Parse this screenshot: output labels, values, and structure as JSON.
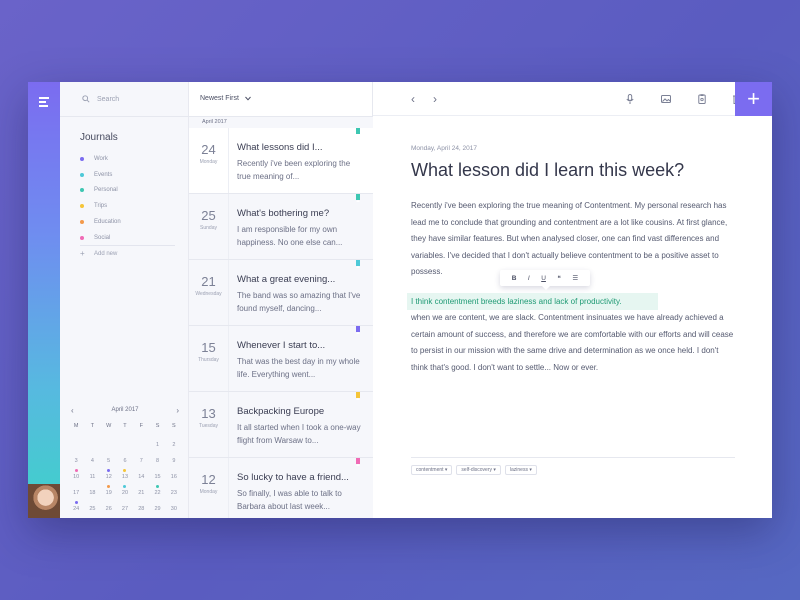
{
  "rail": {
    "menu_icon": "hamburger-icon",
    "avatar": "user-avatar"
  },
  "sidebar": {
    "search_placeholder": "Search",
    "journals_title": "Journals",
    "journals": [
      {
        "label": "Work",
        "color": "#7b6cf0"
      },
      {
        "label": "Events",
        "color": "#4ec9d8"
      },
      {
        "label": "Personal",
        "color": "#3ec7b2"
      },
      {
        "label": "Trips",
        "color": "#f5c538"
      },
      {
        "label": "Education",
        "color": "#f39a4b"
      },
      {
        "label": "Social",
        "color": "#f06bb5"
      }
    ],
    "add_new_label": "Add new",
    "calendar": {
      "month_label": "April 2017",
      "weekdays": [
        "M",
        "T",
        "W",
        "T",
        "F",
        "S",
        "S"
      ],
      "rows": [
        [
          "",
          "",
          "",
          "",
          "",
          "1",
          "2"
        ],
        [
          "3",
          "4",
          "5",
          "6",
          "7",
          "8",
          "9"
        ],
        [
          "10",
          "11",
          "12",
          "13",
          "14",
          "15",
          "16"
        ],
        [
          "17",
          "18",
          "19",
          "20",
          "21",
          "22",
          "23"
        ],
        [
          "24",
          "25",
          "26",
          "27",
          "28",
          "29",
          "30"
        ]
      ],
      "markers": {
        "10": "#f06bb5",
        "12": "#7b6cf0",
        "13": "#f5c538",
        "19": "#f39a4b",
        "20": "#4ec9d8",
        "22": "#3ec7b2",
        "24": "#7b6cf0"
      }
    }
  },
  "entries": {
    "sort_label": "Newest First",
    "month_header": "April 2017",
    "items": [
      {
        "day": "24",
        "weekday": "Monday",
        "title": "What lessons did I...",
        "snippet": "Recently i've been exploring the true meaning of...",
        "flag": "#3ec7b2",
        "shade": false
      },
      {
        "day": "25",
        "weekday": "Sunday",
        "title": "What's bothering me?",
        "snippet": "I am responsible for my own happiness. No one else can...",
        "flag": "#3ec7b2",
        "shade": true
      },
      {
        "day": "21",
        "weekday": "Wednesday",
        "title": "What a great evening...",
        "snippet": "The band was so amazing that I've found myself, dancing...",
        "flag": "#4ec9d8",
        "shade": true
      },
      {
        "day": "15",
        "weekday": "Thursday",
        "title": "Whenever I start to...",
        "snippet": "That was the best day in my whole life. Everything went...",
        "flag": "#7b6cf0",
        "shade": true
      },
      {
        "day": "13",
        "weekday": "Tuesday",
        "title": "Backpacking Europe",
        "snippet": "It all started when I took a one-way flight from Warsaw to...",
        "flag": "#f5c538",
        "shade": true
      },
      {
        "day": "12",
        "weekday": "Monday",
        "title": "So lucky to have a friend...",
        "snippet": "So finally, I was able to talk to Barbara about last week...",
        "flag": "#f06bb5",
        "shade": true
      }
    ]
  },
  "editor": {
    "toolbar": {
      "back_icon": "chevron-left-icon",
      "forward_icon": "chevron-right-icon",
      "mic_icon": "microphone-icon",
      "image_icon": "image-icon",
      "clipboard_icon": "clipboard-icon",
      "trash_icon": "trash-icon",
      "add_label": "+"
    },
    "date": "Monday, April 24, 2017",
    "title": "What lesson did I learn this week?",
    "body_before": "Recently i've been exploring the true meaning of Contentment. My personal research has lead me to conclude that grounding and contentment are a lot like cousins. At first glance, they have similar features. But when analysed closer, one can find vast differences and variables. I've decided that I don't actually believe contentment to be a positive asset to possess.",
    "highlight": "I think contentment breeds laziness and lack of productivity.",
    "body_after": "when we are content, we are slack. Contentment insinuates we have already achieved a certain amount of success, and therefore we are comfortable with our efforts and will cease to persist in our mission with the same drive and determination as we once held. I don't think that's good. I don't want to settle... Now or ever.",
    "format_bar": {
      "bold": "B",
      "italic": "I",
      "underline": "U",
      "quote": "❝",
      "list": "☰"
    },
    "tags": [
      "contentment ▾",
      "self-discovery ▾",
      "laziness ▾"
    ]
  }
}
